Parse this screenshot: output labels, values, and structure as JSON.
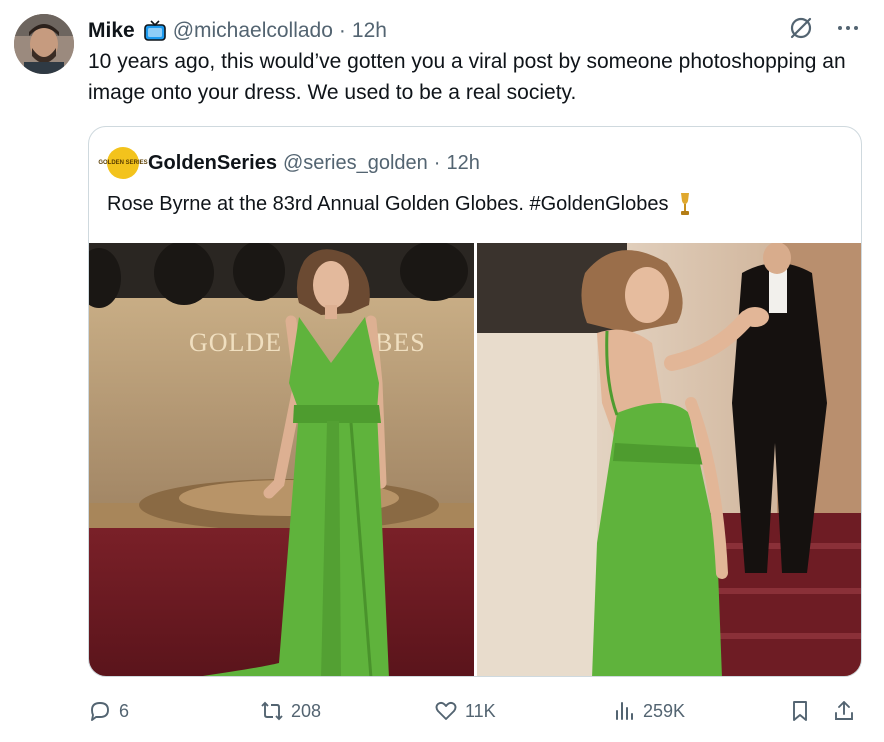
{
  "post": {
    "author_name": "Mike",
    "author_handle": "@michaelcollado",
    "separator": "·",
    "time": "12h",
    "text": "10 years ago, this would’ve gotten you a viral post by someone photoshopping an image onto your dress. We used to be a real society."
  },
  "quote": {
    "logo_text": "GOLDEN SERIES",
    "author_name": "GoldenSeries",
    "author_handle": "@series_golden",
    "separator": "·",
    "time": "12h",
    "text": "Rose Byrne at the 83rd Annual Golden Globes. #GoldenGlobes",
    "backdrop_left_text": "GOLDE",
    "backdrop_right_text": "BES"
  },
  "actions": {
    "replies": "6",
    "reposts": "208",
    "likes": "11K",
    "views": "259K"
  },
  "icons": {
    "badge": "tv-icon",
    "grok": "slashed-circle-icon",
    "more": "more-icon",
    "reply": "reply-icon",
    "repost": "repost-icon",
    "like": "heart-icon",
    "views": "views-icon",
    "bookmark": "bookmark-icon",
    "share": "share-icon"
  },
  "colors": {
    "dress_green": "#5fb33c",
    "carpet": "#6e1c24",
    "gold_wall": "#b89c76",
    "muted_text": "#536471"
  }
}
